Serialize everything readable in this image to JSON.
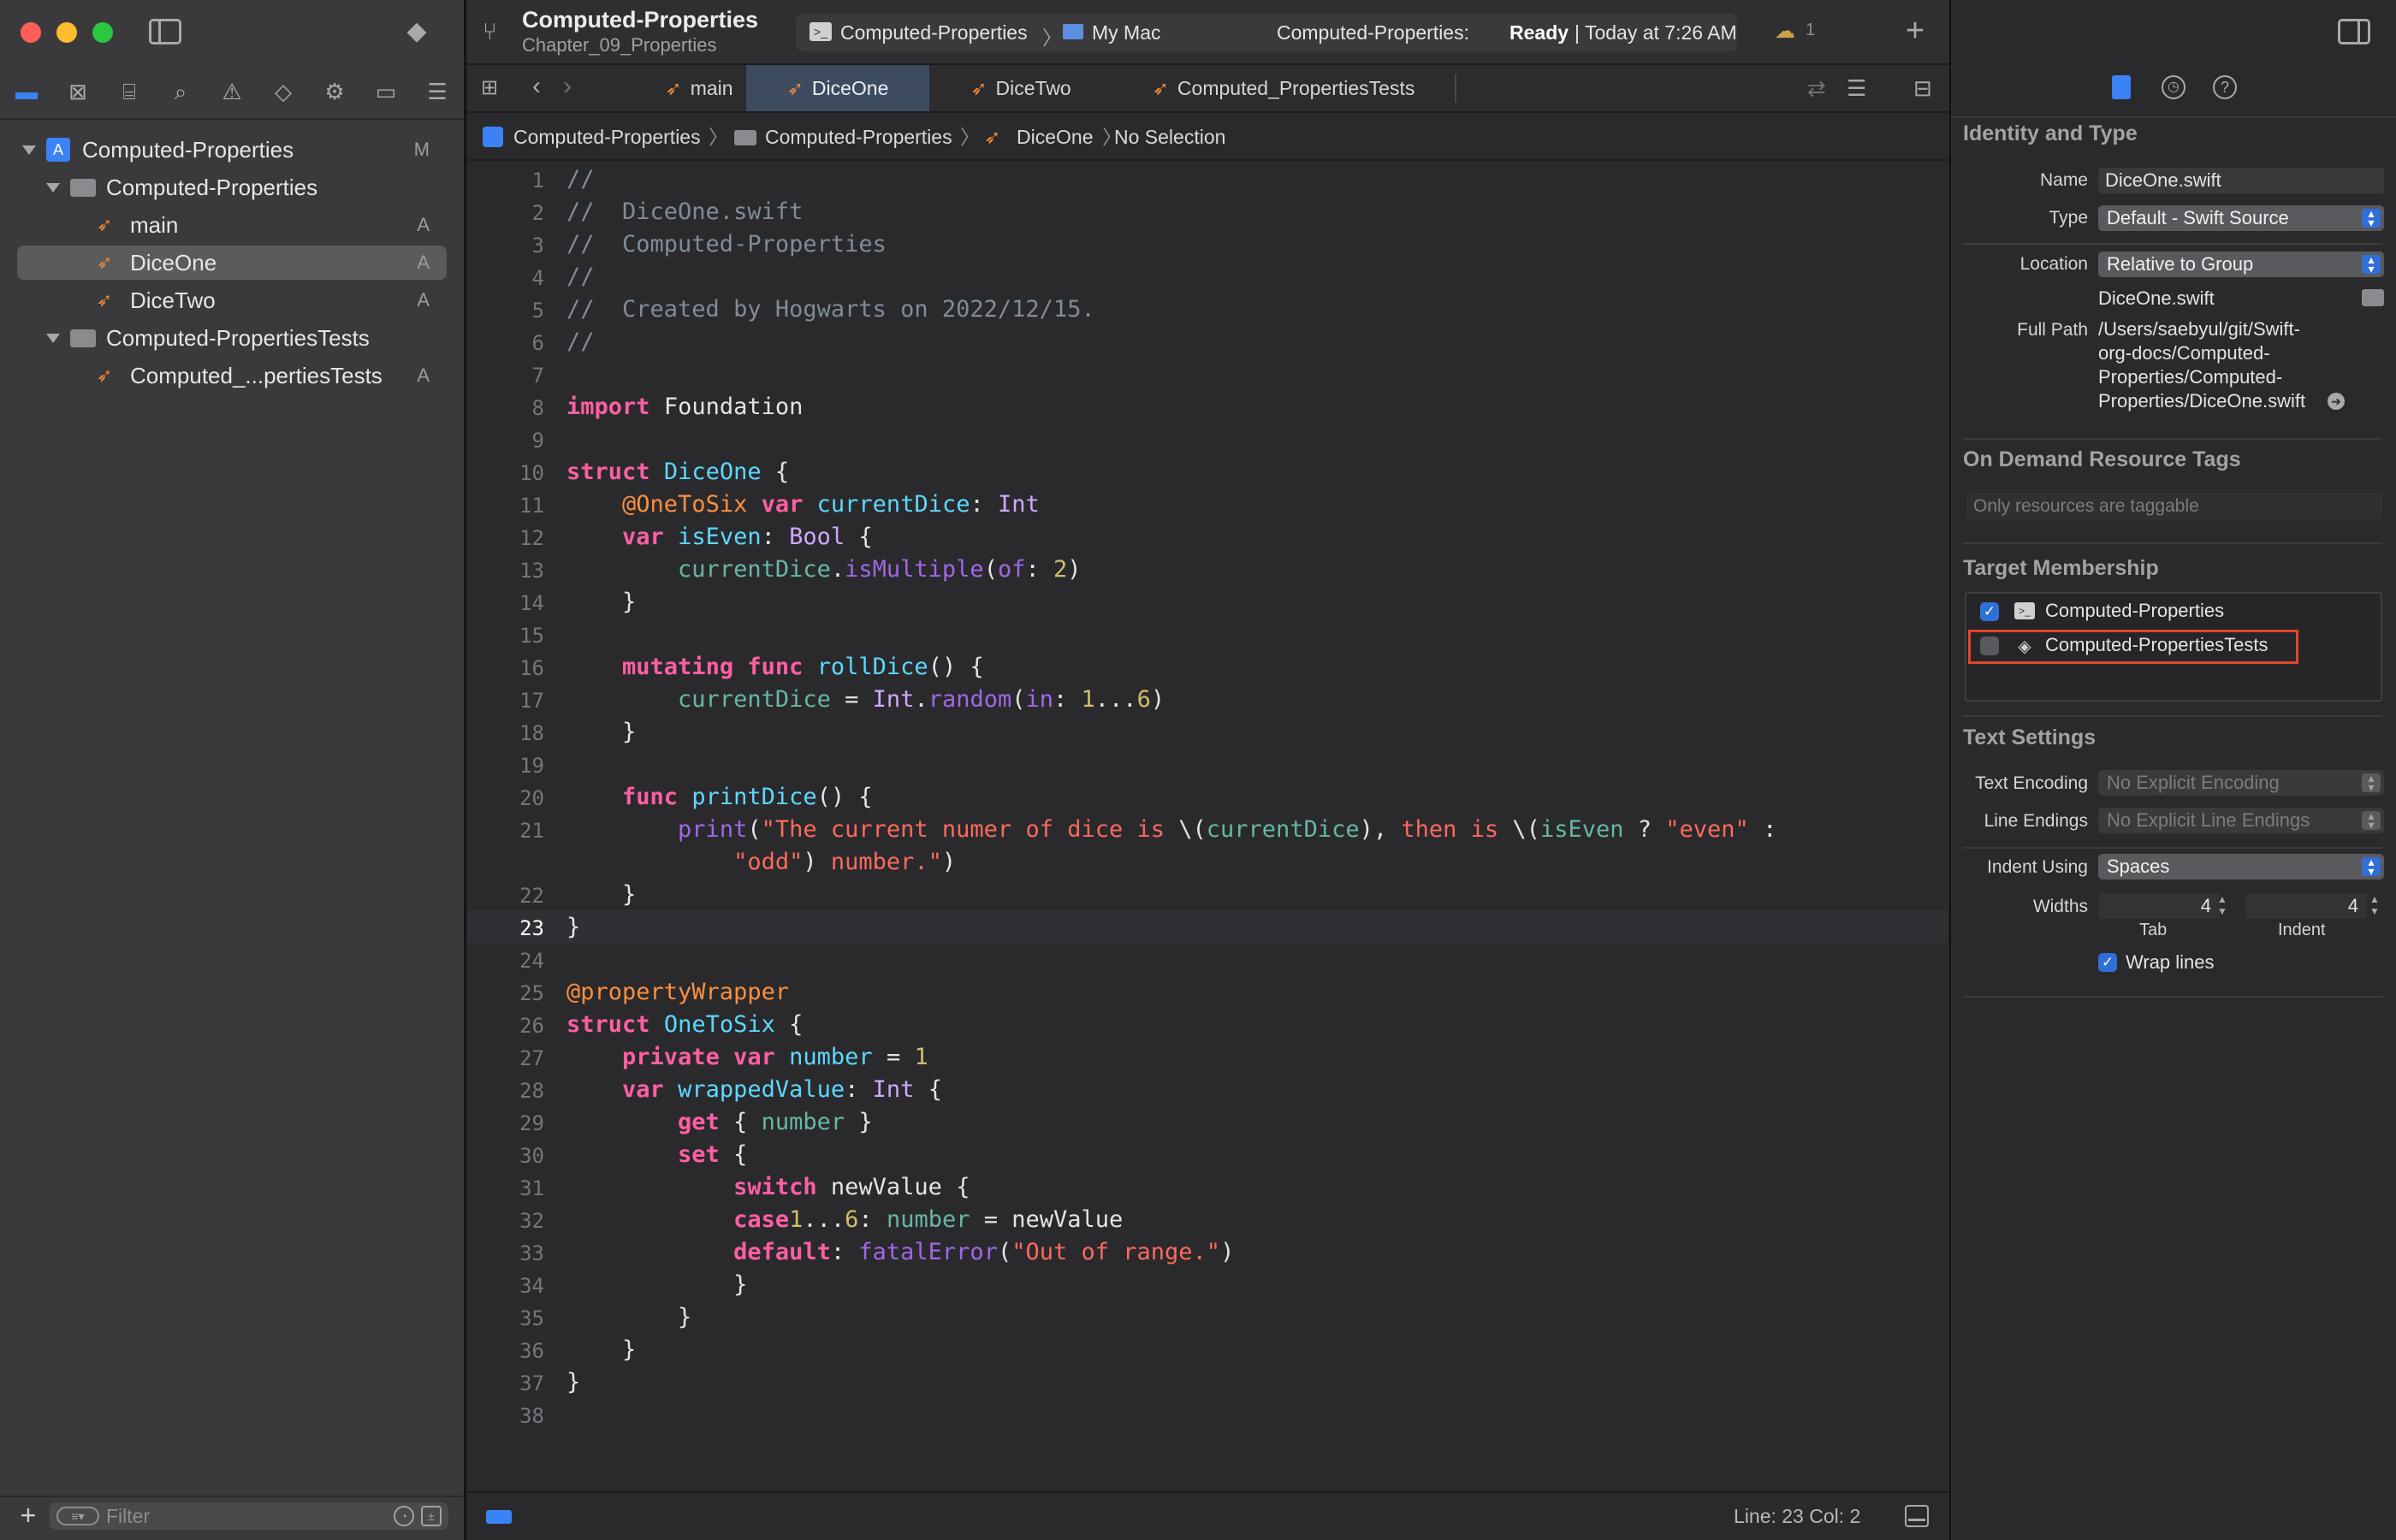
{
  "window": {
    "project_title": "Computed-Properties",
    "project_subtitle": "Chapter_09_Properties",
    "scheme": "Computed-Properties",
    "destination": "My Mac",
    "status_prefix": "Computed-Properties:",
    "status_state": "Ready",
    "status_time": "| Today at 7:26 AM",
    "warnings_count": "1"
  },
  "navigator": {
    "items": [
      {
        "label": "Computed-Properties",
        "badge": "M",
        "kind": "project"
      },
      {
        "label": "Computed-Properties",
        "badge": "",
        "kind": "folder"
      },
      {
        "label": "main",
        "badge": "A",
        "kind": "swift"
      },
      {
        "label": "DiceOne",
        "badge": "A",
        "kind": "swift"
      },
      {
        "label": "DiceTwo",
        "badge": "A",
        "kind": "swift"
      },
      {
        "label": "Computed-PropertiesTests",
        "badge": "",
        "kind": "folder"
      },
      {
        "label": "Computed_...pertiesTests",
        "badge": "A",
        "kind": "swift"
      }
    ],
    "filter_placeholder": "Filter"
  },
  "tabs": [
    {
      "label": "main"
    },
    {
      "label": "DiceOne"
    },
    {
      "label": "DiceTwo"
    },
    {
      "label": "Computed_PropertiesTests"
    }
  ],
  "jumpbar": {
    "project": "Computed-Properties",
    "group": "Computed-Properties",
    "file": "DiceOne",
    "selection": "No Selection"
  },
  "code": {
    "line_numbers": [
      "1",
      "2",
      "3",
      "4",
      "5",
      "6",
      "7",
      "8",
      "9",
      "10",
      "11",
      "12",
      "13",
      "14",
      "15",
      "16",
      "17",
      "18",
      "19",
      "20",
      "21",
      "22",
      "23",
      "24",
      "25",
      "26",
      "27",
      "28",
      "29",
      "30",
      "31",
      "32",
      "33",
      "34",
      "35",
      "36",
      "37",
      "38"
    ],
    "current_line": "23"
  },
  "status": {
    "line_col": "Line: 23  Col: 2"
  },
  "inspector": {
    "identity_title": "Identity and Type",
    "name_label": "Name",
    "name_value": "DiceOne.swift",
    "type_label": "Type",
    "type_value": "Default - Swift Source",
    "location_label": "Location",
    "location_value": "Relative to Group",
    "location_file": "DiceOne.swift",
    "fullpath_label": "Full Path",
    "fullpath_lines": [
      "/Users/saebyul/git/Swift-",
      "org-docs/Computed-",
      "Properties/Computed-",
      "Properties/DiceOne.swift"
    ],
    "odr_title": "On Demand Resource Tags",
    "odr_placeholder": "Only resources are taggable",
    "target_title": "Target Membership",
    "target_1": "Computed-Properties",
    "target_1_checked": true,
    "target_2": "Computed-PropertiesTests",
    "target_2_checked": false,
    "text_title": "Text Settings",
    "encoding_label": "Text Encoding",
    "encoding_value": "No Explicit Encoding",
    "endings_label": "Line Endings",
    "endings_value": "No Explicit Line Endings",
    "indent_label": "Indent Using",
    "indent_value": "Spaces",
    "widths_label": "Widths",
    "tab_width": "4",
    "indent_width": "4",
    "tab_caption": "Tab",
    "indent_caption": "Indent",
    "wrap_label": "Wrap lines",
    "wrap_checked": true
  },
  "colors": {
    "accent": "#2f6fd8",
    "highlight_box": "#e0452d",
    "swift_orange": "#f08a36",
    "keyword": "#fc5fa3",
    "string": "#fc6a5d"
  }
}
